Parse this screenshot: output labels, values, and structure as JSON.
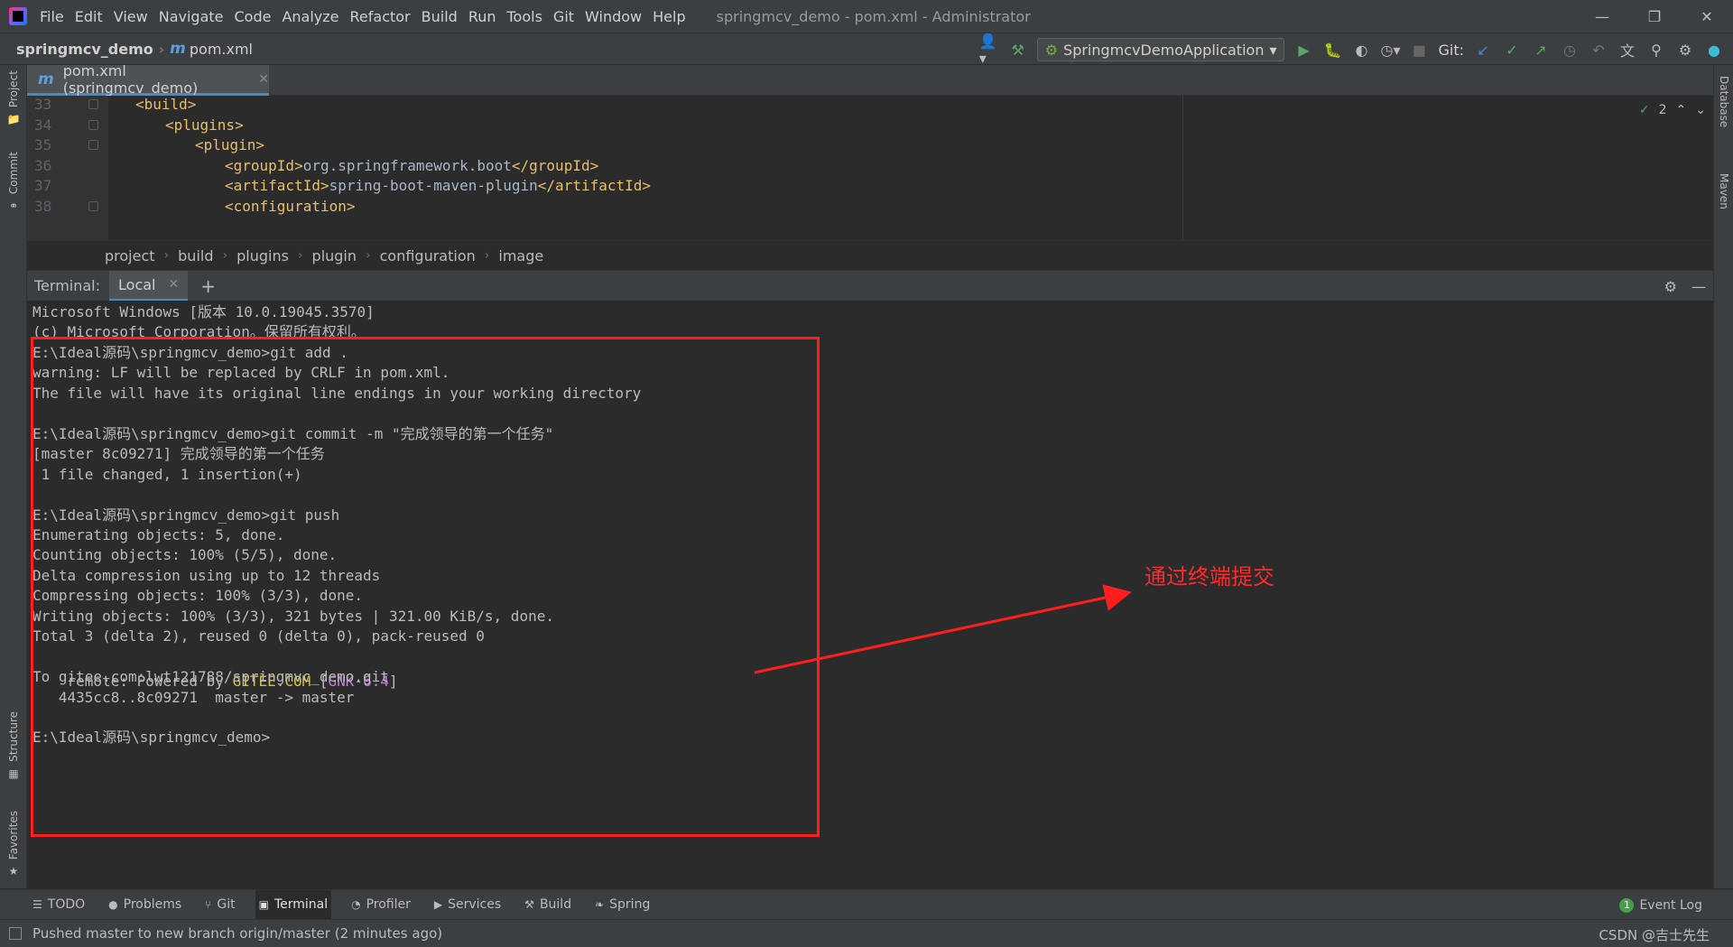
{
  "menubar": {
    "items": [
      "File",
      "Edit",
      "View",
      "Navigate",
      "Code",
      "Analyze",
      "Refactor",
      "Build",
      "Run",
      "Tools",
      "Git",
      "Window",
      "Help"
    ],
    "window_title": "springmcv_demo - pom.xml - Administrator"
  },
  "navbar": {
    "project": "springmcv_demo",
    "file": "pom.xml",
    "run_config": "SpringmcvDemoApplication",
    "git_label": "Git:"
  },
  "left_stripe": {
    "project": "Project",
    "commit": "Commit",
    "structure": "Structure",
    "favorites": "Favorites"
  },
  "right_stripe": {
    "database": "Database",
    "maven": "Maven"
  },
  "editor_tab": {
    "label": "pom.xml (springmcv_demo)"
  },
  "editor": {
    "inspection_count": "2",
    "lines": [
      {
        "num": "33",
        "indent": 3,
        "tag_open": "<build>",
        "text": "",
        "tag_close": ""
      },
      {
        "num": "34",
        "indent": 4,
        "tag_open": "<plugins>",
        "text": "",
        "tag_close": ""
      },
      {
        "num": "35",
        "indent": 5,
        "tag_open": "<plugin>",
        "text": "",
        "tag_close": ""
      },
      {
        "num": "36",
        "indent": 6,
        "tag_open": "<groupId>",
        "text": "org.springframework.boot",
        "tag_close": "</groupId>"
      },
      {
        "num": "37",
        "indent": 6,
        "tag_open": "<artifactId>",
        "text": "spring-boot-maven-plugin",
        "tag_close": "</artifactId>"
      },
      {
        "num": "38",
        "indent": 6,
        "tag_open": "<configuration>",
        "text": "",
        "tag_close": ""
      }
    ]
  },
  "breadcrumb": [
    "project",
    "build",
    "plugins",
    "plugin",
    "configuration",
    "image"
  ],
  "terminal": {
    "label": "Terminal:",
    "tab": "Local",
    "lines": [
      "Microsoft Windows [版本 10.0.19045.3570]",
      "(c) Microsoft Corporation。保留所有权利。",
      "E:\\Ideal源码\\springmcv_demo>git add .",
      "warning: LF will be replaced by CRLF in pom.xml.",
      "The file will have its original line endings in your working directory",
      "",
      "E:\\Ideal源码\\springmcv_demo>git commit -m \"完成领导的第一个任务\"",
      "[master 8c09271] 完成领导的第一个任务",
      " 1 file changed, 1 insertion(+)",
      "",
      "E:\\Ideal源码\\springmcv_demo>git push",
      "Enumerating objects: 5, done.",
      "Counting objects: 100% (5/5), done.",
      "Delta compression using up to 12 threads",
      "Compressing objects: 100% (3/3), done.",
      "Writing objects: 100% (3/3), 321 bytes | 321.00 KiB/s, done.",
      "Total 3 (delta 2), reused 0 (delta 0), pack-reused 0"
    ],
    "remote_prefix": "remote: Powered by ",
    "remote_gitee": "GITEE.COM",
    "remote_bracket_open": " [",
    "remote_gnk": "GNK-6.4",
    "remote_bracket_close": "]",
    "lines_after": [
      "To gitee.com:lwt121788/springmvc_demo.git",
      "   4435cc8..8c09271  master -> master",
      "",
      "E:\\Ideal源码\\springmcv_demo>"
    ]
  },
  "annotation": {
    "text": "通过终端提交",
    "color": "#ff2a2a"
  },
  "bottom_bar": {
    "items": [
      {
        "icon": "list-icon",
        "label": "TODO"
      },
      {
        "icon": "problems-icon",
        "label": "Problems"
      },
      {
        "icon": "git-branch-icon",
        "label": "Git"
      },
      {
        "icon": "terminal-icon",
        "label": "Terminal"
      },
      {
        "icon": "profiler-icon",
        "label": "Profiler"
      },
      {
        "icon": "services-icon",
        "label": "Services"
      },
      {
        "icon": "build-hammer-icon",
        "label": "Build"
      },
      {
        "icon": "spring-icon",
        "label": "Spring"
      }
    ],
    "event_log": "Event Log",
    "event_count": "1"
  },
  "status_bar": {
    "message": "Pushed master to new branch origin/master (2 minutes ago)",
    "watermark": "CSDN @吉士先生"
  },
  "colors": {
    "accent": "#4a88c7",
    "annotation_red": "#ff1e1e"
  }
}
